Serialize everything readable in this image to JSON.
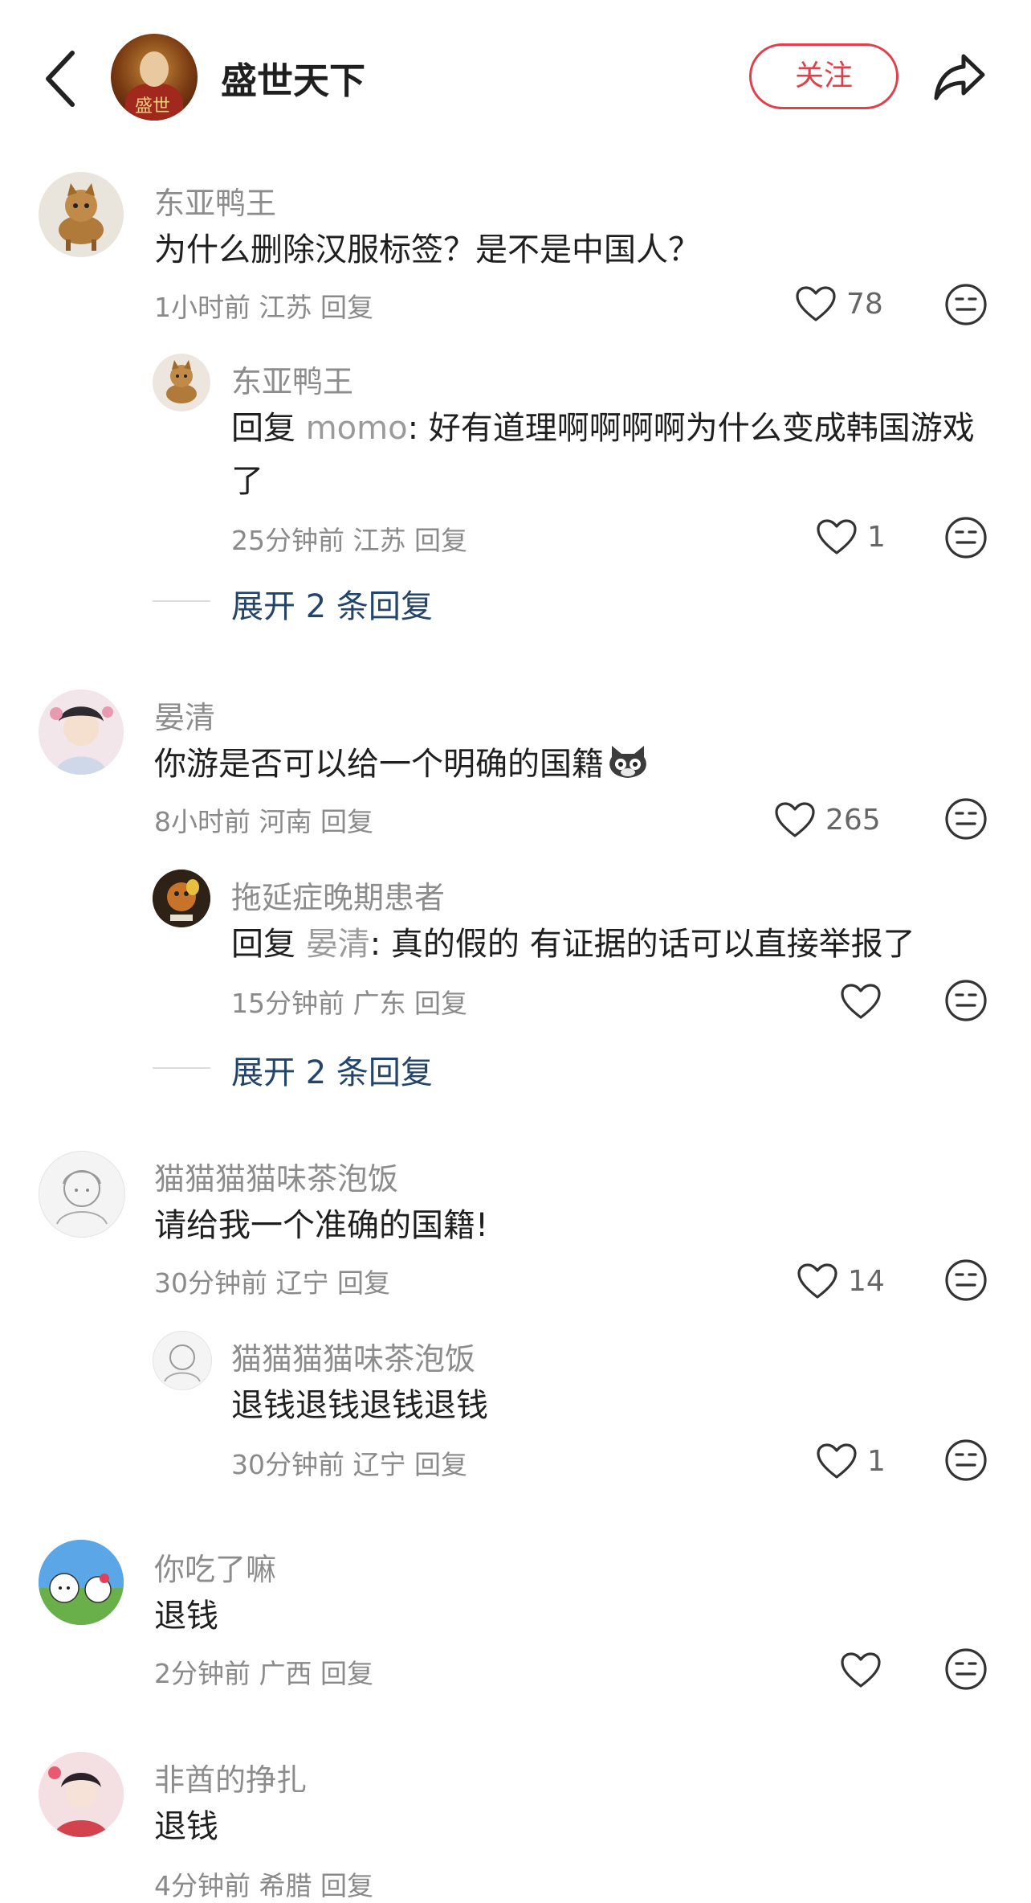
{
  "header": {
    "title": "盛世天下",
    "avatar_text": "盛世",
    "follow_label": "关注"
  },
  "comments": [
    {
      "user": "东亚鸭王",
      "text": "为什么删除汉服标签？是不是中国人？",
      "meta": "1小时前 江苏 回复",
      "likes": "78",
      "reply": {
        "user": "东亚鸭王",
        "prefix": "回复 ",
        "mention": "momo",
        "text_line1": ": 好有道理啊啊啊啊为什么变成韩国游戏",
        "text_line2": "了",
        "meta": "25分钟前 江苏 回复",
        "likes": "1"
      },
      "expand": "展开 2 条回复"
    },
    {
      "user": "晏清",
      "text": "你游是否可以给一个明确的国籍",
      "meta": "8小时前 河南 回复",
      "likes": "265",
      "reply": {
        "user": "拖延症晚期患者",
        "prefix": "回复 ",
        "mention": "晏清",
        "text_line1": ": 真的假的 有证据的话可以直接举报了",
        "meta": "15分钟前 广东 回复",
        "likes": ""
      },
      "expand": "展开 2 条回复"
    },
    {
      "user": "猫猫猫猫味茶泡饭",
      "text": "请给我一个准确的国籍!",
      "meta": "30分钟前 辽宁 回复",
      "likes": "14",
      "reply": {
        "user": "猫猫猫猫味茶泡饭",
        "text_line1": "退钱退钱退钱退钱",
        "meta": "30分钟前 辽宁 回复",
        "likes": "1"
      }
    },
    {
      "user": "你吃了嘛",
      "text": "退钱",
      "meta": "2分钟前 广西 回复",
      "likes": ""
    },
    {
      "user": "非酋的挣扎",
      "text": "退钱",
      "meta": "4分钟前 希腊 回复",
      "likes": ""
    }
  ],
  "colors": {
    "follow": "#e0404a",
    "expand": "#24456a",
    "meta": "#8a8a8a",
    "username": "#8c8c8c"
  },
  "icons": [
    "back-icon",
    "share-icon",
    "heart-icon",
    "emoji-icon"
  ]
}
